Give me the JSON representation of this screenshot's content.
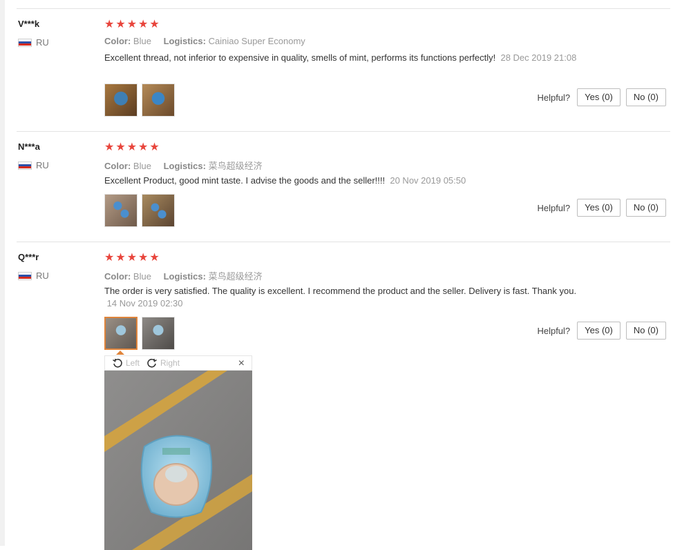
{
  "header_fragment": "...",
  "helpful_label": "Helpful?",
  "colors": {
    "star": "#e8453c",
    "selected_thumb": "#e0843a",
    "divider": "#e3e3e3"
  },
  "reviews": [
    {
      "user": "V***k",
      "country": "RU",
      "rating": 5,
      "color_label": "Color:",
      "color_value": "Blue",
      "logistics_label": "Logistics:",
      "logistics_value": "Cainiao Super Economy",
      "text": "Excellent thread, not inferior to expensive in quality, smells of mint, performs its functions perfectly!",
      "date": "28 Dec 2019 21:08",
      "yes": "Yes (0)",
      "no": "No (0)"
    },
    {
      "user": "N***a",
      "country": "RU",
      "rating": 5,
      "color_label": "Color:",
      "color_value": "Blue",
      "logistics_label": "Logistics:",
      "logistics_value": "菜鸟超级经济",
      "text": "Excellent Product, good mint taste. I advise the goods and the seller!!!!",
      "date": "20 Nov 2019 05:50",
      "yes": "Yes (0)",
      "no": "No (0)"
    },
    {
      "user": "Q***r",
      "country": "RU",
      "rating": 5,
      "color_label": "Color:",
      "color_value": "Blue",
      "logistics_label": "Logistics:",
      "logistics_value": "菜鸟超级经济",
      "text": "The order is very satisfied. The quality is excellent. I recommend the product and the seller. Delivery is fast. Thank you.",
      "date": "14 Nov 2019 02:30",
      "yes": "Yes (0)",
      "no": "No (0)"
    }
  ],
  "viewer": {
    "rotate_left": "Left",
    "rotate_right": "Right",
    "close": "×"
  }
}
